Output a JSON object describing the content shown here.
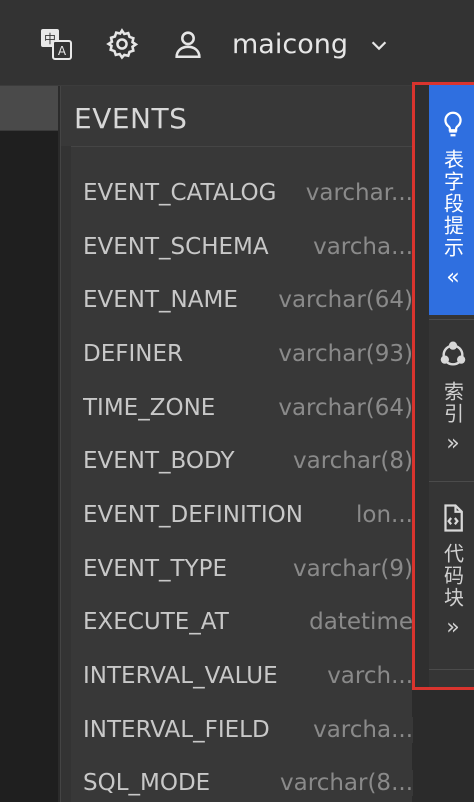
{
  "header": {
    "username": "maicong",
    "icons": [
      "translate-icon",
      "gear-icon",
      "user-icon",
      "chevron-down-icon"
    ]
  },
  "panel": {
    "title": "EVENTS",
    "fields": [
      {
        "name": "EVENT_CATALOG",
        "type": "varchar..."
      },
      {
        "name": "EVENT_SCHEMA",
        "type": "varcha..."
      },
      {
        "name": "EVENT_NAME",
        "type": "varchar(64)"
      },
      {
        "name": "DEFINER",
        "type": "varchar(93)"
      },
      {
        "name": "TIME_ZONE",
        "type": "varchar(64)"
      },
      {
        "name": "EVENT_BODY",
        "type": "varchar(8)"
      },
      {
        "name": "EVENT_DEFINITION",
        "type": "lon..."
      },
      {
        "name": "EVENT_TYPE",
        "type": "varchar(9)"
      },
      {
        "name": "EXECUTE_AT",
        "type": "datetime"
      },
      {
        "name": "INTERVAL_VALUE",
        "type": "varch..."
      },
      {
        "name": "INTERVAL_FIELD",
        "type": "varcha..."
      },
      {
        "name": "SQL_MODE",
        "type": "varchar(8..."
      }
    ]
  },
  "sidebar": {
    "tabs": [
      {
        "label": "表字段提示",
        "chevron": "«",
        "icon": "lightbulb-icon",
        "active": true
      },
      {
        "label": "索引",
        "chevron": "»",
        "icon": "index-graph-icon",
        "active": false
      },
      {
        "label": "代码块",
        "chevron": "»",
        "icon": "code-file-icon",
        "active": false
      }
    ]
  },
  "colors": {
    "accent": "#2f6fe0",
    "highlight_border": "#d9342e",
    "panel_bg": "#383838",
    "topbar_bg": "#333333"
  }
}
